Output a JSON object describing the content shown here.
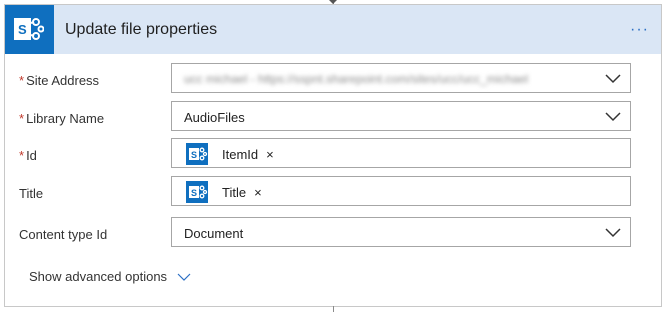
{
  "action": {
    "title": "Update file properties",
    "menu_label": "···"
  },
  "fields": {
    "site_address": {
      "label": "Site Address",
      "required": "*",
      "value": "ucc michael - https://sspnt.sharepoint.com/sites/ucc/ucc_michael"
    },
    "library_name": {
      "label": "Library Name",
      "required": "*",
      "value": "AudioFiles"
    },
    "id": {
      "label": "Id",
      "required": "*",
      "token": "ItemId",
      "remove": "×"
    },
    "title": {
      "label": "Title",
      "token": "Title",
      "remove": "×"
    },
    "content_type": {
      "label": "Content type Id",
      "value": "Document"
    }
  },
  "advanced": {
    "label": "Show advanced options"
  },
  "colors": {
    "accent": "#0f6fbf",
    "header_bg": "#dae6f5",
    "required": "#c0392b"
  },
  "icons": [
    "sharepoint-icon",
    "chevron-down-icon",
    "more-icon",
    "close-icon"
  ]
}
